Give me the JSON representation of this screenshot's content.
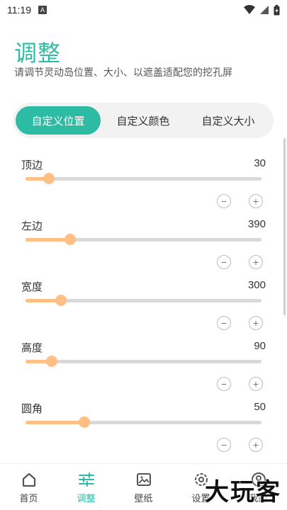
{
  "status_bar": {
    "time": "11:19",
    "notif_letter": "A"
  },
  "header": {
    "title": "调整",
    "subtitle": "请调节灵动岛位置、大小、以遮盖适配您的挖孔屏"
  },
  "segments": [
    {
      "label": "自定义位置",
      "active": true
    },
    {
      "label": "自定义颜色",
      "active": false
    },
    {
      "label": "自定义大小",
      "active": false
    }
  ],
  "settings": [
    {
      "label": "顶边",
      "value": "30",
      "fraction": 0.1
    },
    {
      "label": "左边",
      "value": "390",
      "fraction": 0.19
    },
    {
      "label": "宽度",
      "value": "300",
      "fraction": 0.15
    },
    {
      "label": "高度",
      "value": "90",
      "fraction": 0.11
    },
    {
      "label": "圆角",
      "value": "50",
      "fraction": 0.25
    }
  ],
  "stepper": {
    "minus": "−",
    "plus": "+"
  },
  "tabs": [
    {
      "label": "首页",
      "icon": "home-icon",
      "active": false
    },
    {
      "label": "调整",
      "icon": "sliders-icon",
      "active": true
    },
    {
      "label": "壁纸",
      "icon": "image-icon",
      "active": false
    },
    {
      "label": "设置",
      "icon": "settings-icon",
      "active": false
    },
    {
      "label": "我的",
      "icon": "user-icon",
      "active": false
    }
  ],
  "watermark": "大玩客",
  "colors": {
    "accent": "#2dbba3",
    "slider": "#ffbf85",
    "track": "#d9d9d9"
  }
}
